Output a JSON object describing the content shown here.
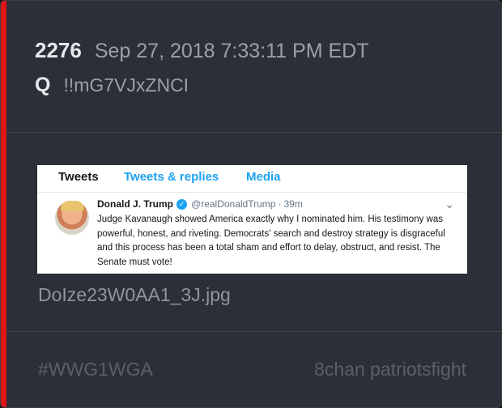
{
  "post": {
    "number": "2276",
    "datetime": "Sep 27, 2018 7:33:11 PM EDT",
    "author": "Q",
    "tripcode": "!!mG7VJxZNCI"
  },
  "attachment": {
    "filename": "DoIze23W0AA1_3J.jpg",
    "tweet": {
      "tabs": [
        "Tweets",
        "Tweets & replies",
        "Media"
      ],
      "name": "Donald J. Trump",
      "handle": "@realDonaldTrump",
      "separator": "·",
      "time": "39m",
      "text": "Judge Kavanaugh showed America exactly why I nominated him. His testimony was powerful, honest, and riveting. Democrats' search and destroy strategy is disgraceful and this process has been a total sham and effort to delay, obstruct, and resist. The Senate must vote!"
    }
  },
  "footer": {
    "hashtag": "#WWG1WGA",
    "source": "8chan patriotsfight"
  },
  "colors": {
    "accent": "#e01414",
    "card_bg": "#2b2f37",
    "twitter_blue": "#1da1f2"
  }
}
